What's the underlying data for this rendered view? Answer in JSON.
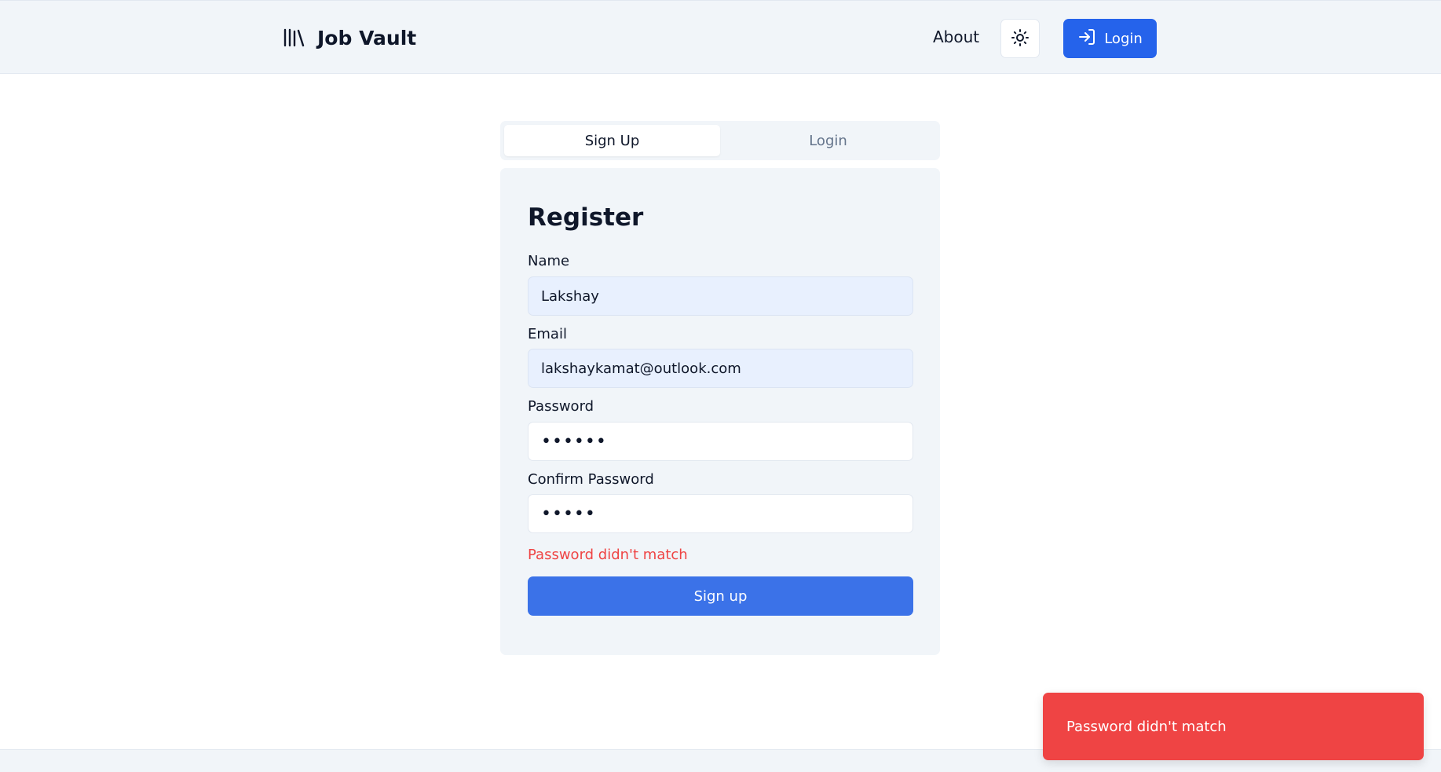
{
  "header": {
    "brand_name": "Job Vault",
    "brand_icon": "library-icon",
    "nav_about": "About",
    "theme_icon": "sun-icon",
    "login_label": "Login",
    "login_icon": "log-in-icon"
  },
  "tabs": [
    {
      "label": "Sign Up",
      "active": true
    },
    {
      "label": "Login",
      "active": false
    }
  ],
  "form": {
    "title": "Register",
    "name_label": "Name",
    "name_value": "Lakshay",
    "email_label": "Email",
    "email_value": "lakshaykamat@outlook.com",
    "password_label": "Password",
    "password_value": "••••••",
    "confirm_label": "Confirm Password",
    "confirm_value": "•••••",
    "error_text": "Password didn't match",
    "submit_label": "Sign up"
  },
  "toast": {
    "message": "Password didn't match"
  },
  "colors": {
    "primary": "#2563eb",
    "danger": "#ef4444",
    "surface": "#f1f5f9"
  }
}
